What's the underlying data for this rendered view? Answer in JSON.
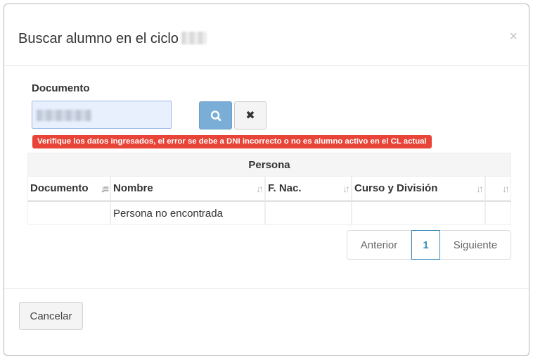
{
  "modal": {
    "title": "Buscar alumno en el ciclo",
    "close_glyph": "×"
  },
  "form": {
    "document_label": "Documento",
    "error_message": "Verifique los datos ingresados, el error se debe a DNI incorrecto o no es alumno activo en el CL actual",
    "clear_glyph": "✖"
  },
  "icons": {
    "search": "search-icon",
    "clear": "times-icon",
    "close": "close-icon",
    "sort": "sort-icon"
  },
  "table": {
    "group_header": "Persona",
    "columns": [
      "Documento",
      "Nombre",
      "F. Nac.",
      "Curso y División",
      ""
    ],
    "rows": [
      [
        "",
        "Persona no encontrada",
        "",
        "",
        ""
      ]
    ]
  },
  "pagination": {
    "prev_label": "Anterior",
    "current_page": "1",
    "next_label": "Siguiente"
  },
  "footer": {
    "cancel_label": "Cancelar"
  },
  "colors": {
    "error": "#e84438",
    "search_button": "#7aaed6",
    "active_page": "#3c8dbc"
  }
}
